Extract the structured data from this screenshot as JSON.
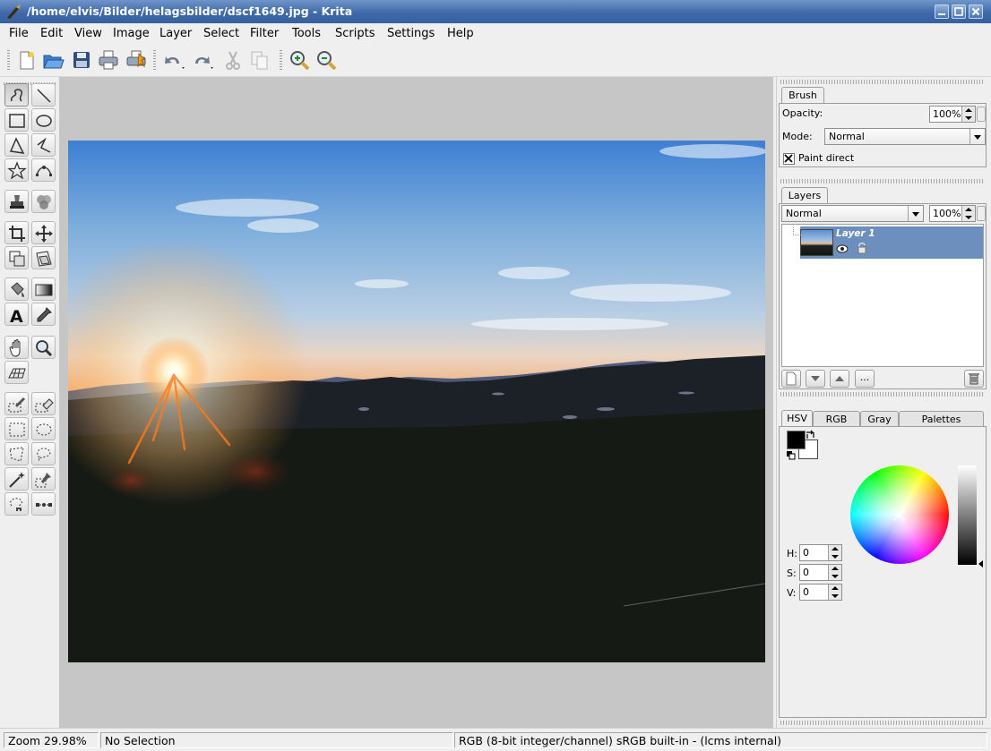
{
  "window": {
    "title": "/home/elvis/Bilder/helagsbilder/dscf1649.jpg - Krita",
    "accent": "#3f69a8"
  },
  "menubar": {
    "items": [
      "File",
      "Edit",
      "View",
      "Image",
      "Layer",
      "Select",
      "Filter",
      "Tools",
      "Scripts",
      "Settings",
      "Help"
    ]
  },
  "toolbar": {
    "buttons": [
      "new-icon",
      "open-icon",
      "save-icon",
      "print-icon",
      "print-preview-icon",
      "undo-icon",
      "redo-icon",
      "cut-icon",
      "copy-icon",
      "zoom-in-icon",
      "zoom-out-icon"
    ]
  },
  "brush_panel": {
    "tab": "Brush",
    "opacity_label": "Opacity:",
    "opacity_value": "100%",
    "mode_label": "Mode:",
    "mode_value": "Normal",
    "paint_direct_label": "Paint direct",
    "paint_direct_checked": true
  },
  "layers_panel": {
    "tab": "Layers",
    "blend_mode": "Normal",
    "opacity_value": "100%",
    "layers": [
      {
        "name": "Layer 1",
        "visible": true,
        "locked": false
      }
    ],
    "more_label": "..."
  },
  "color_panel": {
    "tabs": [
      "HSV",
      "RGB",
      "Gray",
      "Palettes"
    ],
    "active_tab": "HSV",
    "foreground": "#000000",
    "background": "#ffffff",
    "h_label": "H:",
    "h_value": "0",
    "s_label": "S:",
    "s_value": "0",
    "v_label": "V:",
    "v_value": "0"
  },
  "statusbar": {
    "zoom": "Zoom 29.98%",
    "selection": "No Selection",
    "color_info": "RGB (8-bit integer/channel)  sRGB built-in - (lcms internal)"
  }
}
